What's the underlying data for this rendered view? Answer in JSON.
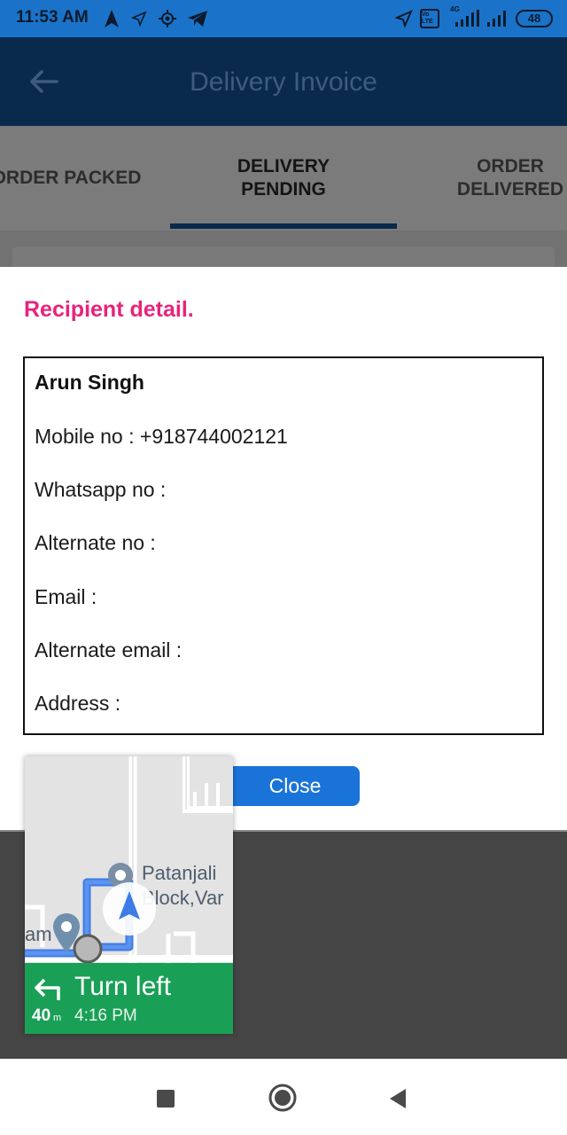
{
  "status_bar": {
    "time": "11:53 AM",
    "icons_left": [
      "navigation-arrow-icon",
      "location-outline-icon",
      "gps-target-icon",
      "telegram-icon"
    ],
    "icons_right": [
      "location-icon",
      "volte-icon",
      "signal-4g-icon",
      "signal-icon"
    ],
    "network_label": "4G",
    "volte_label": "Vo LTE",
    "battery": "48"
  },
  "app_bar": {
    "title": "Delivery Invoice"
  },
  "tabs": [
    {
      "label": "ORDER PACKED",
      "active": false
    },
    {
      "label": "DELIVERY PENDING",
      "active": true
    },
    {
      "label": "ORDER DELIVERED",
      "active": false
    }
  ],
  "dialog": {
    "heading": "Recipient detail.",
    "name": "Arun Singh",
    "lines": [
      "Mobile no : +918744002121",
      "Whatsapp no :",
      "Alternate no :",
      "Email :",
      "Alternate email :",
      "Address :"
    ],
    "close_label": "Close"
  },
  "map_overlay": {
    "place_label_line1": "Patanjali",
    "place_label_line2": "Block,Var",
    "side_label": "am",
    "instruction": "Turn left",
    "distance": "40",
    "distance_unit": "m",
    "eta": "4:16 PM"
  },
  "colors": {
    "status_bar": "#1a73c8",
    "app_bar": "#0a2a4c",
    "heading": "#e6247a",
    "close_button": "#1a73d8",
    "nav_card": "#19a056"
  }
}
